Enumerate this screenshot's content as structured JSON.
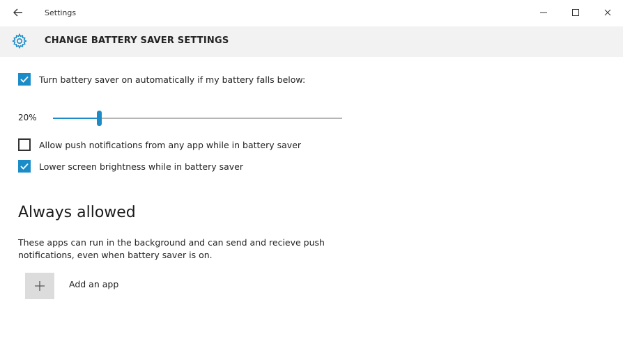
{
  "window": {
    "title": "Settings"
  },
  "header": {
    "title": "CHANGE BATTERY SAVER SETTINGS",
    "icon": "gear-icon"
  },
  "settings": {
    "auto_on": {
      "label": "Turn battery saver on automatically if my battery falls below:",
      "checked": true
    },
    "threshold": {
      "value_label": "20%",
      "value": 20,
      "min": 5,
      "max": 100
    },
    "push_notifications": {
      "label": "Allow push notifications from any app while in battery saver",
      "checked": false
    },
    "lower_brightness": {
      "label": "Lower screen brightness while in battery saver",
      "checked": true
    }
  },
  "always_allowed": {
    "heading": "Always allowed",
    "description": "These apps can run in the background and can send and recieve push notifications, even when battery saver is on.",
    "add_label": "Add an app"
  },
  "colors": {
    "accent": "#1c8cc8",
    "header_bg": "#f2f2f2"
  }
}
